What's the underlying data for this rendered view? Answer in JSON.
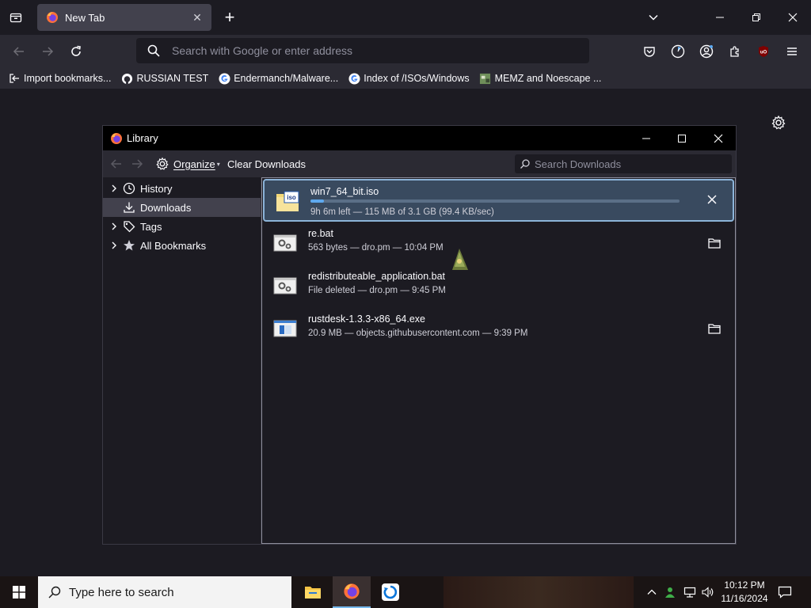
{
  "browser": {
    "tab": {
      "title": "New Tab",
      "close": "✕"
    },
    "new_tab": "+",
    "urlbar": {
      "placeholder": "Search with Google or enter address"
    },
    "bookmarks": [
      {
        "label": "Import bookmarks...",
        "icon": "import-icon"
      },
      {
        "label": "RUSSIAN TEST",
        "icon": "github-icon"
      },
      {
        "label": "Endermanch/Malware...",
        "icon": "google-icon"
      },
      {
        "label": "Index of /ISOs/Windows",
        "icon": "google-icon"
      },
      {
        "label": "MEMZ and Noescape ...",
        "icon": "image-favicon"
      }
    ]
  },
  "library": {
    "title": "Library",
    "toolbar": {
      "organize": "Organize",
      "clear_downloads": "Clear Downloads",
      "search_placeholder": "Search Downloads"
    },
    "sidebar": [
      {
        "label": "History",
        "icon": "clock-icon",
        "expandable": true
      },
      {
        "label": "Downloads",
        "icon": "download-icon",
        "expandable": false,
        "selected": true
      },
      {
        "label": "Tags",
        "icon": "tag-icon",
        "expandable": true
      },
      {
        "label": "All Bookmarks",
        "icon": "star-icon",
        "expandable": true
      }
    ],
    "downloads": [
      {
        "name": "win7_64_bit.iso",
        "status": "9h 6m left — 115 MB of 3.1 GB (99.4 KB/sec)",
        "progress": 0.037,
        "icon": "iso-file-icon",
        "action": "cancel"
      },
      {
        "name": "re.bat",
        "status": "563 bytes — dro.pm — 10:04 PM",
        "icon": "batch-file-icon",
        "action": "show-folder"
      },
      {
        "name": "redistributeable_application.bat",
        "status": "File deleted — dro.pm — 9:45 PM",
        "icon": "batch-file-icon",
        "action": "none"
      },
      {
        "name": "rustdesk-1.3.3-x86_64.exe",
        "status": "20.9 MB — objects.githubusercontent.com — 9:39 PM",
        "icon": "exe-file-icon",
        "action": "show-folder"
      }
    ]
  },
  "taskbar": {
    "search_placeholder": "Type here to search",
    "apps": [
      "file-explorer-icon",
      "firefox-icon",
      "rustdesk-icon"
    ],
    "clock": {
      "time": "10:12 PM",
      "date": "11/16/2024"
    }
  },
  "colors": {
    "accent_progress": "#5ea9ef",
    "active_download_bg": "#394a5f",
    "chrome_bg": "#2b2a33",
    "page_bg": "#1c1b22"
  }
}
